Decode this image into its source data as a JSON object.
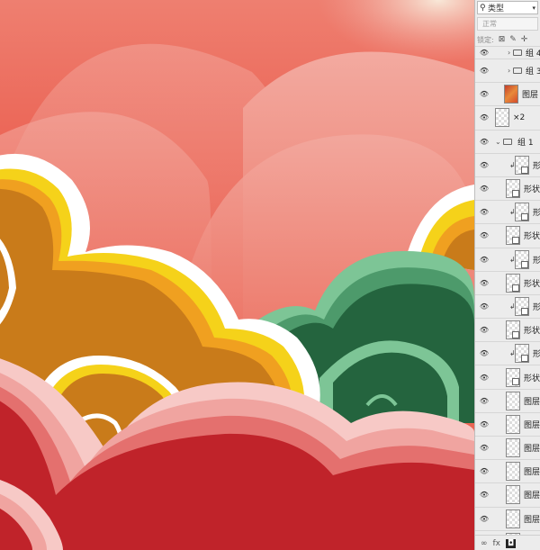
{
  "panel": {
    "filter_kind": "类型",
    "blend_mode": "正常",
    "lock_label": "锁定:",
    "lock_icons": [
      "lock-transparent-icon",
      "brush-icon",
      "move-icon"
    ],
    "layers": [
      {
        "name": "组 4",
        "kind": "group",
        "expanded": false,
        "indent": 1,
        "short": true
      },
      {
        "name": "组 3",
        "kind": "group",
        "expanded": false,
        "indent": 1
      },
      {
        "name": "图层",
        "kind": "image",
        "clipped": true
      },
      {
        "name": "×2",
        "kind": "layer"
      },
      {
        "name": "组 1",
        "kind": "group",
        "expanded": true
      },
      {
        "name": "形",
        "kind": "shape",
        "clipped": true
      },
      {
        "name": "形状",
        "kind": "shape"
      },
      {
        "name": "形",
        "kind": "shape",
        "clipped": true
      },
      {
        "name": "形状",
        "kind": "shape"
      },
      {
        "name": "形",
        "kind": "shape",
        "clipped": true
      },
      {
        "name": "形状",
        "kind": "shape"
      },
      {
        "name": "形",
        "kind": "shape",
        "clipped": true
      },
      {
        "name": "形状",
        "kind": "shape"
      },
      {
        "name": "形",
        "kind": "shape",
        "clipped": true
      },
      {
        "name": "形状",
        "kind": "shape"
      },
      {
        "name": "图层",
        "kind": "pixel"
      },
      {
        "name": "图层",
        "kind": "pixel"
      },
      {
        "name": "图层",
        "kind": "pixel"
      },
      {
        "name": "图层",
        "kind": "pixel"
      },
      {
        "name": "图层",
        "kind": "pixel"
      },
      {
        "name": "图层",
        "kind": "pixel"
      },
      {
        "name": "图层",
        "kind": "pixel"
      }
    ],
    "footer": {
      "link": "∞",
      "fx": "fx",
      "mask": "◘"
    }
  },
  "colors": {
    "bg_top": "#e8432e",
    "bg_pink": "#f2a49a",
    "gold": "#c97b1a",
    "yellow": "#f5d21a",
    "orange": "#f0a020",
    "green_dark": "#24643e",
    "green_light": "#7dc596",
    "red": "#c0232a",
    "pink_light": "#f7c9c6",
    "white": "#ffffff"
  }
}
